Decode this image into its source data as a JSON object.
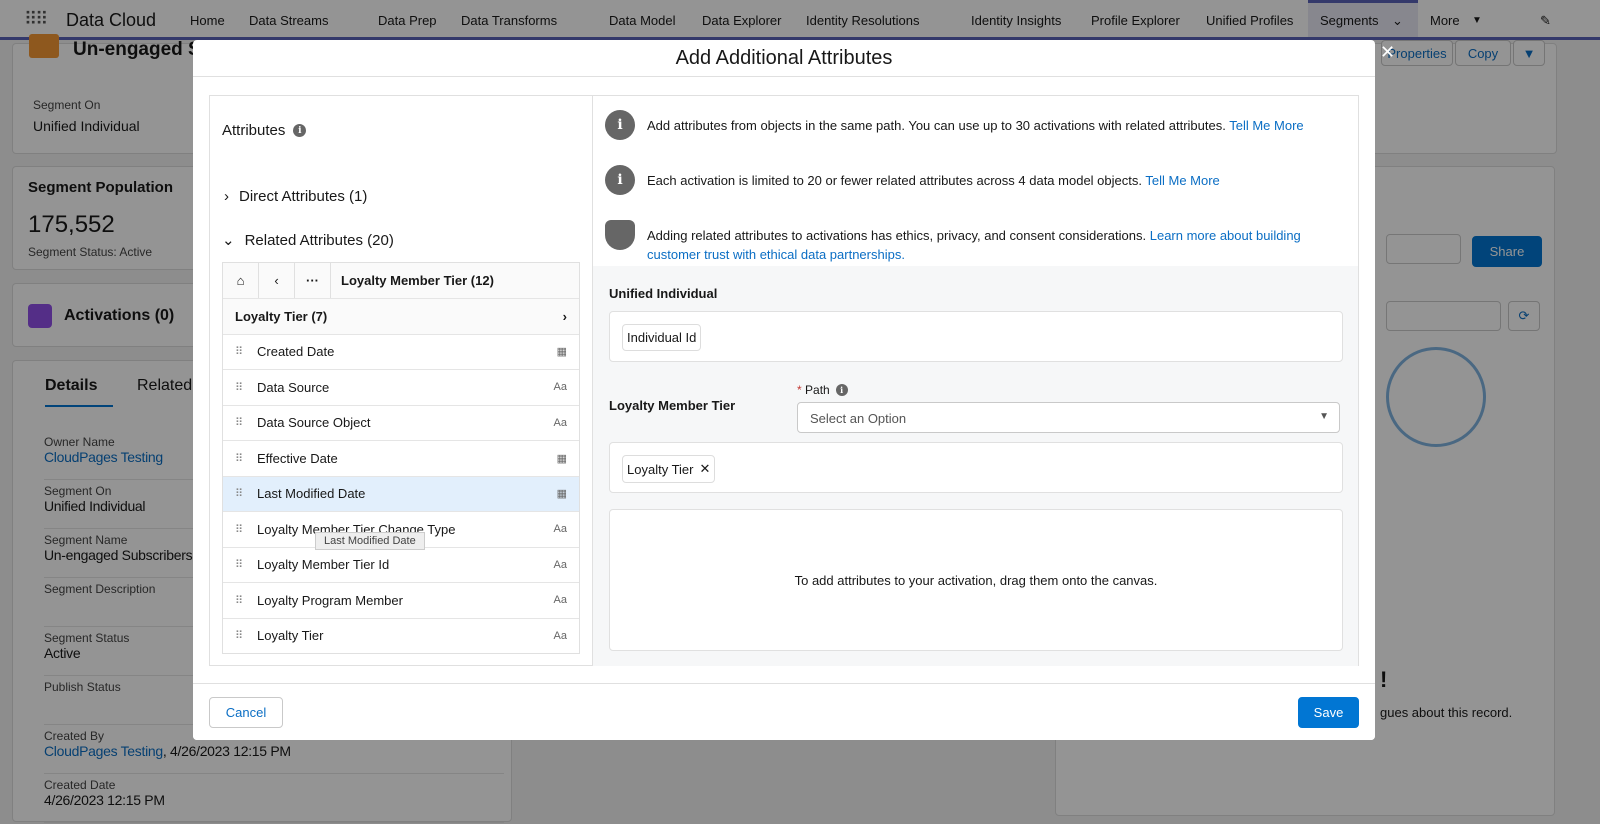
{
  "nav": {
    "app": "Data Cloud",
    "tabs": [
      "Home",
      "Data Streams",
      "Data Prep",
      "Data Transforms",
      "Data Model",
      "Data Explorer",
      "Identity Resolutions",
      "Identity Insights",
      "Profile Explorer",
      "Unified Profiles",
      "Segments",
      "More"
    ]
  },
  "bg": {
    "title": "Un-engaged S",
    "header_buttons": [
      "Properties",
      "Copy"
    ],
    "segment_on_label": "Segment On",
    "segment_on": "Unified Individual",
    "population_title": "Segment Population",
    "population": "175,552",
    "status_line": "Segment Status: Active",
    "activations": "Activations (0)",
    "tabs": [
      "Details",
      "Related"
    ],
    "fields": [
      {
        "label": "Owner Name",
        "value": "CloudPages Testing",
        "link": true
      },
      {
        "label": "Segment On",
        "value": "Unified Individual"
      },
      {
        "label": "Segment Name",
        "value": "Un-engaged Subscribers"
      },
      {
        "label": "Segment Description",
        "value": ""
      },
      {
        "label": "Segment Status",
        "value": "Active"
      },
      {
        "label": "Publish Status",
        "value": ""
      },
      {
        "label": "Created By",
        "value": "CloudPages Testing",
        "suffix": ", 4/26/2023 12:15 PM",
        "link": true
      },
      {
        "label": "Created Date",
        "value": "4/26/2023 12:15 PM"
      }
    ],
    "share": "Share",
    "bang": "!",
    "feed_text": "gues about this record."
  },
  "modal": {
    "title": "Add Additional Attributes",
    "attributes_label": "Attributes",
    "direct": "Direct Attributes (1)",
    "related": "Related Attributes (20)",
    "breadcrumb": "Loyalty Member Tier (12)",
    "group": "Loyalty Tier (7)",
    "items": [
      {
        "name": "Created Date",
        "type": "date"
      },
      {
        "name": "Data Source",
        "type": "text"
      },
      {
        "name": "Data Source Object",
        "type": "text"
      },
      {
        "name": "Effective Date",
        "type": "date"
      },
      {
        "name": "Last Modified Date",
        "type": "date"
      },
      {
        "name": "Loyalty Member Tier Change Type",
        "type": "text"
      },
      {
        "name": "Loyalty Member Tier Id",
        "type": "text"
      },
      {
        "name": "Loyalty Program Member",
        "type": "text"
      },
      {
        "name": "Loyalty Tier",
        "type": "text"
      }
    ],
    "tooltip": "Last Modified Date",
    "type_text": "Aa",
    "info1": "Add attributes from objects in the same path. You can use up to 30 activations with related attributes.",
    "info1_link": "Tell Me More",
    "info2": "Each activation is limited to 20 or fewer related attributes across 4 data model objects.",
    "info2_link": "Tell Me More",
    "info3": "Adding related attributes to activations has ethics, privacy, and consent considerations.",
    "info3_link": "Learn more about building customer trust with ethical data partnerships.",
    "unified_title": "Unified Individual",
    "unified_pill": "Individual Id",
    "lmt_title": "Loyalty Member Tier",
    "path_label": "Path",
    "path_placeholder": "Select an Option",
    "lmt_pill": "Loyalty Tier",
    "drop_text": "To add attributes to your activation, drag them onto the canvas.",
    "cancel": "Cancel",
    "save": "Save"
  }
}
